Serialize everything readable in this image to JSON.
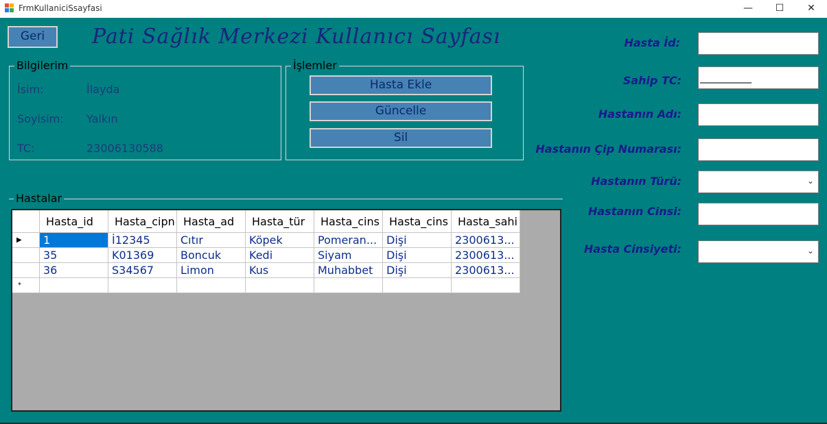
{
  "window": {
    "title": "FrmKullaniciSsayfasi",
    "minimize_glyph": "—",
    "maximize_glyph": "☐",
    "close_glyph": "✕"
  },
  "header": {
    "back_label": "Geri",
    "title": "Pati Sağlık Merkezi Kullanıcı Sayfası"
  },
  "info_group": {
    "legend": "Bilgilerim",
    "rows": [
      {
        "label": "İsim:",
        "value": "İlayda"
      },
      {
        "label": "Soyisim:",
        "value": "Yalkın"
      },
      {
        "label": "TC:",
        "value": "23006130588"
      }
    ]
  },
  "ops_group": {
    "legend": "İşlemler",
    "buttons": [
      "Hasta Ekle",
      "Güncelle",
      "Sil"
    ]
  },
  "patients": {
    "legend": "Hastalar",
    "columns": [
      "Hasta_id",
      "Hasta_cipn",
      "Hasta_ad",
      "Hasta_tür",
      "Hasta_cins",
      "Hasta_cins",
      "Hasta_sahi"
    ],
    "rows": [
      [
        "1",
        "İ12345",
        "Cıtır",
        "Köpek",
        "Pomeran...",
        "Dişi",
        "2300613..."
      ],
      [
        "35",
        "K01369",
        "Boncuk",
        "Kedi",
        "Siyam",
        "Dişi",
        "2300613..."
      ],
      [
        "36",
        "S34567",
        "Limon",
        "Kus",
        "Muhabbet",
        "Dişi",
        "2300613..."
      ]
    ],
    "current_row_marker": "▶",
    "new_row_marker": "*"
  },
  "form": {
    "fields": [
      {
        "label": "Hasta İd:",
        "value": "",
        "type": "text"
      },
      {
        "label": "Sahip TC:",
        "value": "__________",
        "type": "text"
      },
      {
        "label": "Hastanın Adı:",
        "value": "",
        "type": "text"
      },
      {
        "label": "Hastanın Çip Numarası:",
        "value": "",
        "type": "text"
      },
      {
        "label": "Hastanın Türü:",
        "value": "",
        "type": "combo"
      },
      {
        "label": "Hastanın Cinsi:",
        "value": "",
        "type": "text"
      },
      {
        "label": "Hasta Cinsiyeti:",
        "value": "",
        "type": "combo"
      }
    ],
    "combo_arrow": "⌄"
  },
  "colors": {
    "background": "#008080",
    "button": "#4682b4",
    "title": "#1a237e",
    "label": "#1a1a8c",
    "selection": "#0078d7"
  }
}
